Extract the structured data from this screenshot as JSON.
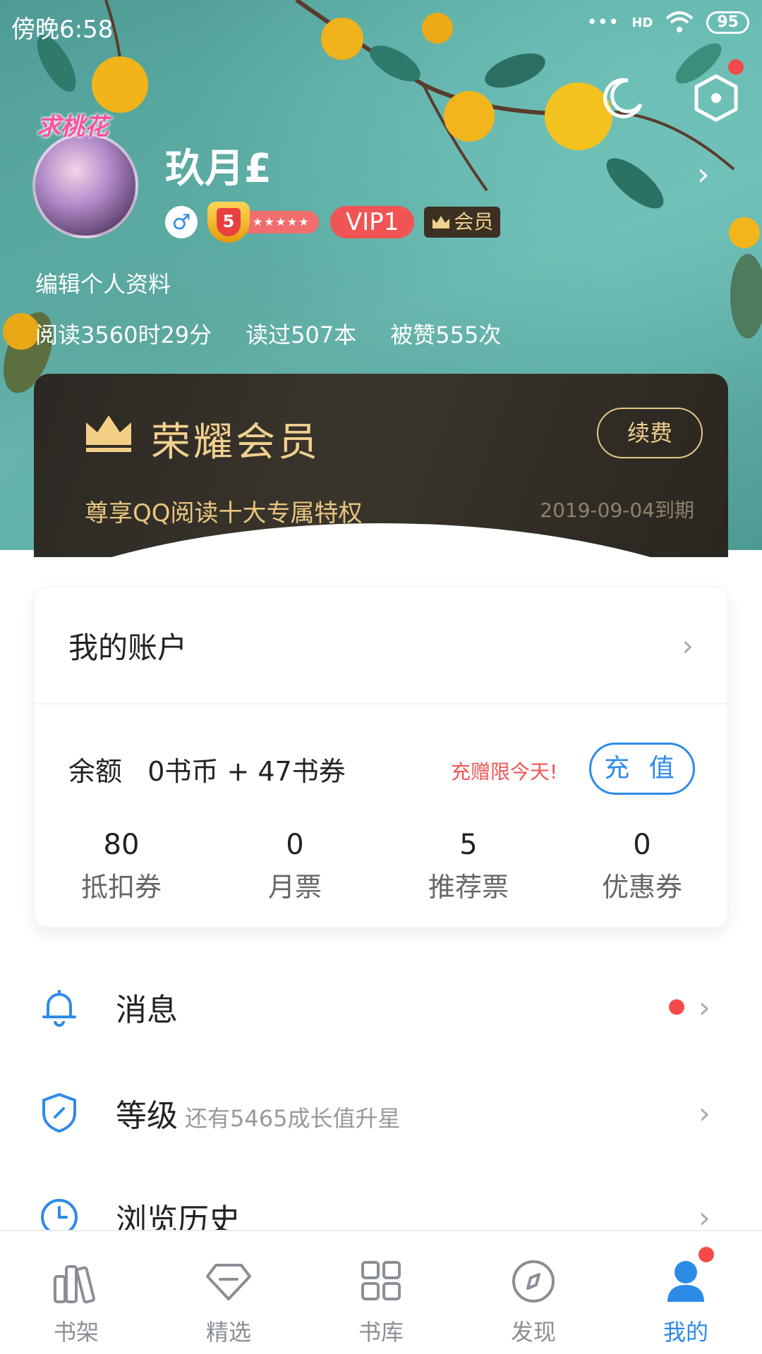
{
  "status_bar": {
    "time": "傍晚6:58",
    "signal": "HD",
    "battery": "95"
  },
  "profile": {
    "avatar_badge": "求桃花",
    "username": "玖月£",
    "gender_symbol": "♂",
    "level": "5",
    "level_stars": "★★★★★",
    "vip": "VIP1",
    "member_label": "会员",
    "edit_label": "编辑个人资料",
    "stats": {
      "reading_time": "阅读3560时29分",
      "books_read": "读过507本",
      "likes": "被赞555次"
    }
  },
  "vip_card": {
    "title": "荣耀会员",
    "renew_label": "续费",
    "subtitle": "尊享QQ阅读十大专属特权",
    "expiry": "2019-09-04到期"
  },
  "account": {
    "title": "我的账户",
    "balance": "余额   0书币 + 47书券",
    "promo": "充赠限今天!",
    "recharge_label": "充 值",
    "counts": [
      {
        "value": "80",
        "label": "抵扣券"
      },
      {
        "value": "0",
        "label": "月票"
      },
      {
        "value": "5",
        "label": "推荐票"
      },
      {
        "value": "0",
        "label": "优惠券"
      }
    ]
  },
  "menu": {
    "messages": {
      "label": "消息",
      "icon": "bell-icon"
    },
    "level": {
      "label": "等级",
      "hint": "还有5465成长值升星",
      "icon": "shield-icon"
    },
    "history": {
      "label": "浏览历史",
      "icon": "clock-icon"
    }
  },
  "tabs": [
    {
      "label": "书架",
      "icon": "bookshelf-icon"
    },
    {
      "label": "精选",
      "icon": "diamond-icon"
    },
    {
      "label": "书库",
      "icon": "grid-icon"
    },
    {
      "label": "发现",
      "icon": "compass-icon"
    },
    {
      "label": "我的",
      "icon": "person-icon",
      "active": true
    }
  ],
  "colors": {
    "accent": "#2d8be8",
    "alert": "#f44a4a",
    "gold": "#f0d08f",
    "vip_red": "#f05454"
  }
}
